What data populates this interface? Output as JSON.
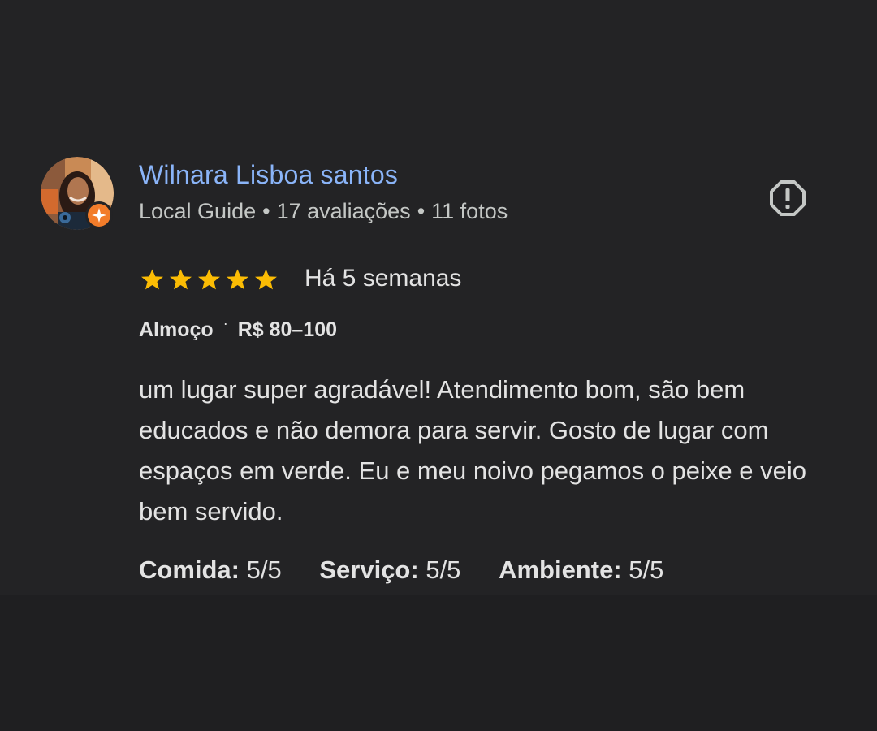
{
  "reviewer": {
    "name": "Wilnara Lisboa santos",
    "level": "Local Guide",
    "separator": "•",
    "reviews_count": "17 avaliações",
    "photos_count": "11 fotos",
    "avatar_icon": "user-photo",
    "badge_icon": "local-guide-star-icon"
  },
  "review": {
    "stars": 5,
    "max_stars": 5,
    "star_color": "#fbbc04",
    "time_ago": "Há 5 semanas",
    "meal_type": "Almoço",
    "meal_separator": "·",
    "price_range": "R$ 80–100",
    "text": "um lugar super agradável! Atendimento bom, são bem educados e não demora para servir. Gosto de lugar com espaços em verde. Eu e meu noivo pegamos o peixe e veio bem servido.",
    "ratings": [
      {
        "label": "Comida:",
        "value": "5/5"
      },
      {
        "label": "Serviço:",
        "value": "5/5"
      },
      {
        "label": "Ambiente:",
        "value": "5/5"
      }
    ]
  },
  "actions": {
    "report_icon": "report-flag-icon"
  },
  "colors": {
    "background": "#1f1f21",
    "card": "#232325",
    "name": "#8ab4f8",
    "badge": "#f27c2a"
  }
}
